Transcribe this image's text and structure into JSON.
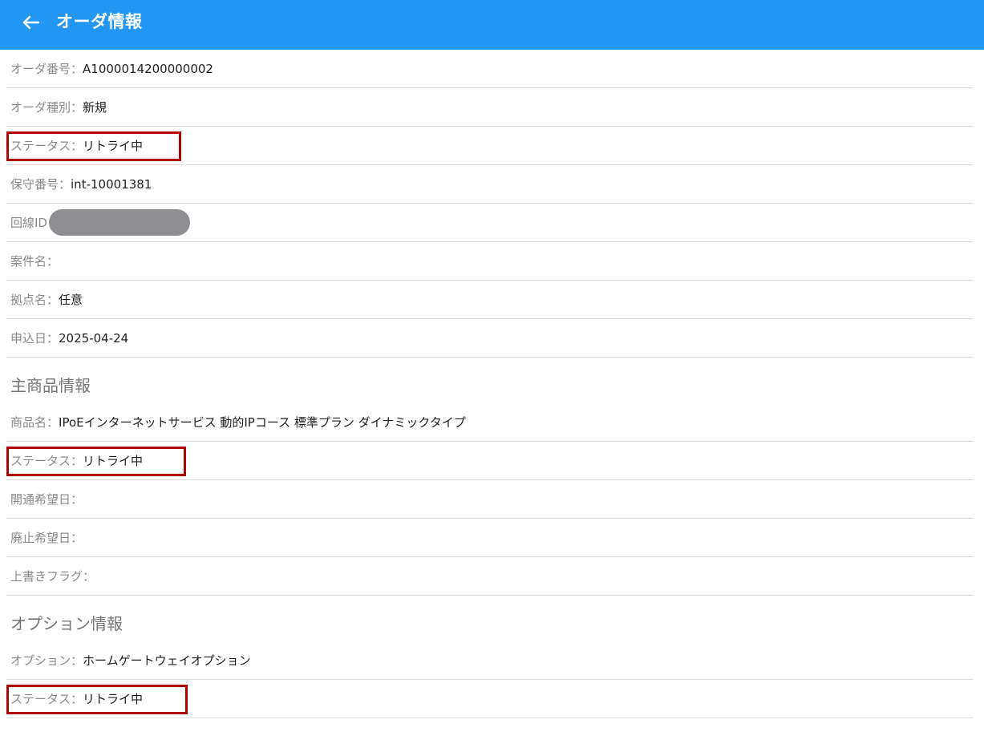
{
  "header": {
    "title": "オーダ情報",
    "back_icon": "arrow-left-icon",
    "color": "#2196f3"
  },
  "order": {
    "order_no": {
      "label": "オーダ番号：",
      "value": "A1000014200000002"
    },
    "order_type": {
      "label": "オーダ種別：",
      "value": "新規"
    },
    "status": {
      "label": "ステータス：",
      "value": "リトライ中"
    },
    "maint_no": {
      "label": "保守番号：",
      "value": "int-10001381"
    },
    "line_id": {
      "label": "回線ID",
      "value": ""
    },
    "project_name": {
      "label": "案件名：",
      "value": ""
    },
    "site_name": {
      "label": "拠点名：",
      "value": "任意"
    },
    "apply_date": {
      "label": "申込日：",
      "value": "2025-04-24"
    }
  },
  "main_product": {
    "title": "主商品情報",
    "product_name": {
      "label": "商品名：",
      "value": "IPoEインターネットサービス 動的IPコース 標準プラン ダイナミックタイプ"
    },
    "status": {
      "label": "ステータス：",
      "value": "リトライ中"
    },
    "open_date": {
      "label": "開通希望日：",
      "value": ""
    },
    "close_date": {
      "label": "廃止希望日：",
      "value": ""
    },
    "overwrite_flag": {
      "label": "上書きフラグ：",
      "value": ""
    }
  },
  "option": {
    "title": "オプション情報",
    "option_name": {
      "label": "オプション：",
      "value": "ホームゲートウェイオプション"
    },
    "status": {
      "label": "ステータス：",
      "value": "リトライ中"
    }
  },
  "highlight_color": "#b00000"
}
